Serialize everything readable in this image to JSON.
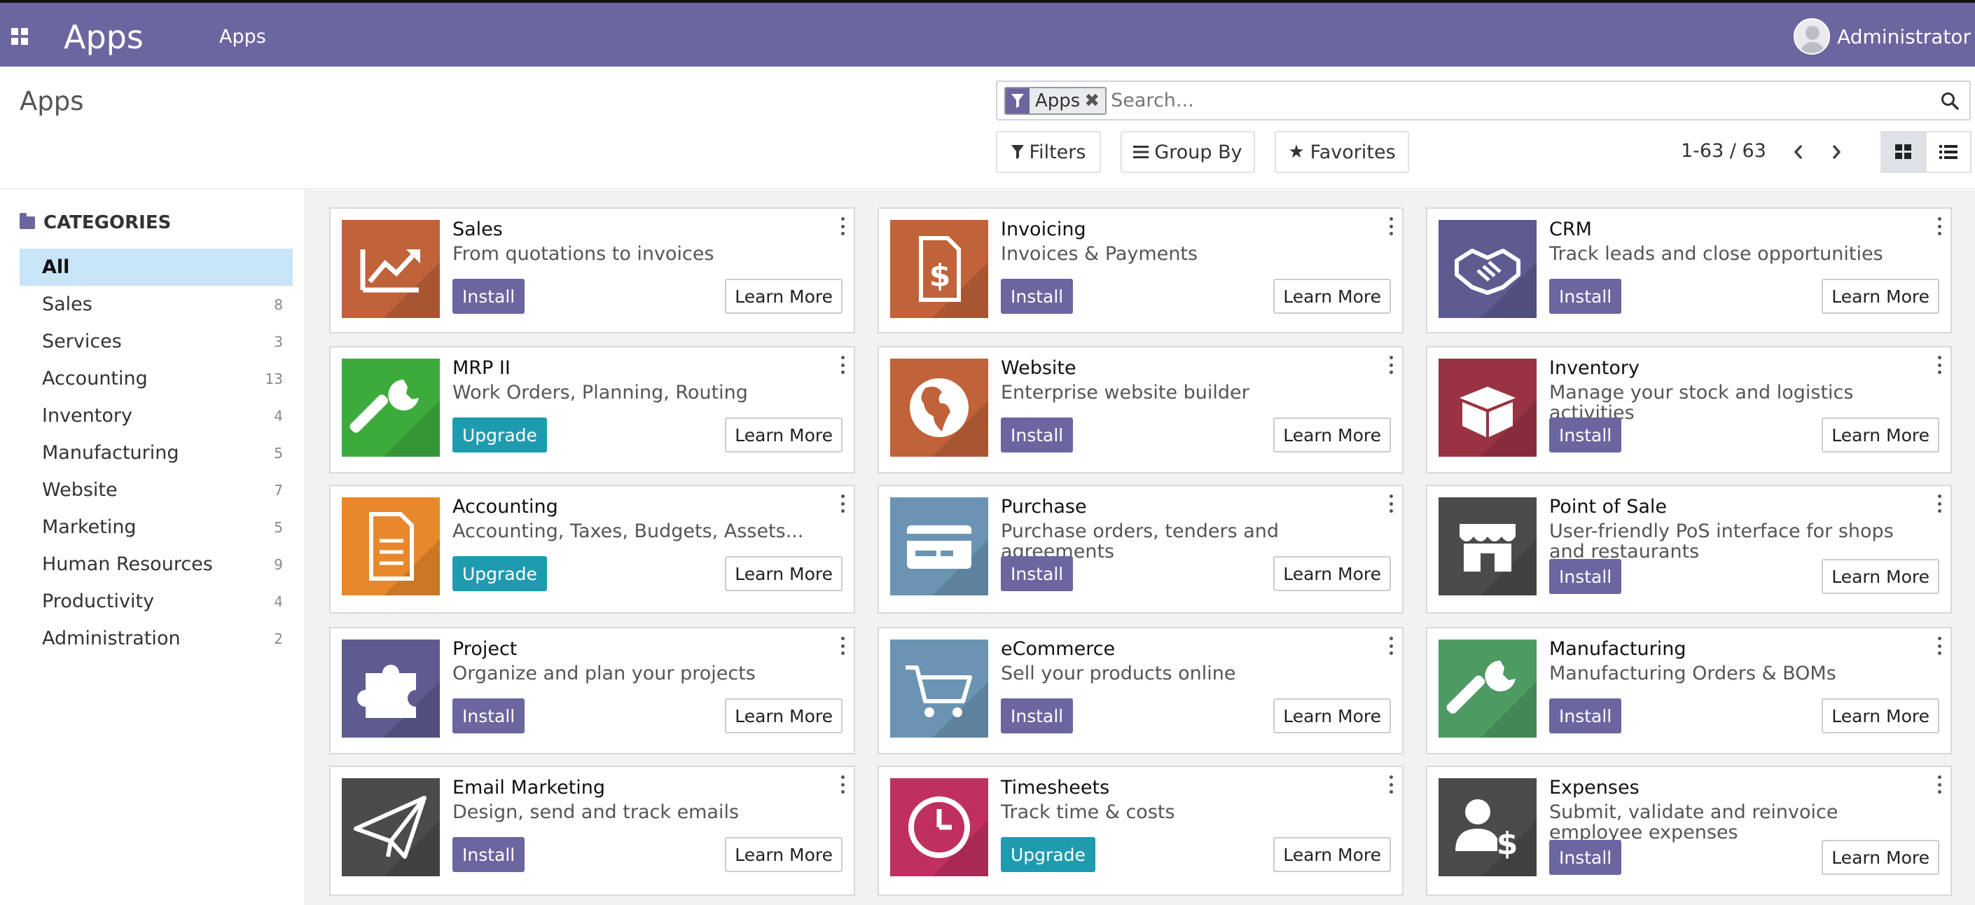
{
  "navbar": {
    "app_title": "Apps",
    "menu_item": "Apps",
    "user_name": "Administrator",
    "bg_color": "#6b65a0"
  },
  "control": {
    "breadcrumb": "Apps",
    "search": {
      "facet_label": "Apps",
      "placeholder": "Search..."
    },
    "filters_label": "Filters",
    "groupby_label": "Group By",
    "favorites_label": "Favorites",
    "pager": "1-63 / 63"
  },
  "sidebar": {
    "heading": "CATEGORIES",
    "items": [
      {
        "label": "All",
        "count": ""
      },
      {
        "label": "Sales",
        "count": "8"
      },
      {
        "label": "Services",
        "count": "3"
      },
      {
        "label": "Accounting",
        "count": "13"
      },
      {
        "label": "Inventory",
        "count": "4"
      },
      {
        "label": "Manufacturing",
        "count": "5"
      },
      {
        "label": "Website",
        "count": "7"
      },
      {
        "label": "Marketing",
        "count": "5"
      },
      {
        "label": "Human Resources",
        "count": "9"
      },
      {
        "label": "Productivity",
        "count": "4"
      },
      {
        "label": "Administration",
        "count": "2"
      }
    ]
  },
  "apps": [
    {
      "name": "Sales",
      "desc": "From quotations to invoices",
      "action": "Install",
      "learn": "Learn More",
      "icon": "trend-chart-icon",
      "color": "#c0623a"
    },
    {
      "name": "Invoicing",
      "desc": "Invoices & Payments",
      "action": "Install",
      "learn": "Learn More",
      "icon": "invoice-document-icon",
      "color": "#c0623a"
    },
    {
      "name": "CRM",
      "desc": "Track leads and close opportunities",
      "action": "Install",
      "learn": "Learn More",
      "icon": "handshake-icon",
      "color": "#5d5b8f"
    },
    {
      "name": "MRP II",
      "desc": "Work Orders, Planning, Routing",
      "action": "Upgrade",
      "learn": "Learn More",
      "icon": "wrench-icon",
      "color": "#3cab3c"
    },
    {
      "name": "Website",
      "desc": "Enterprise website builder",
      "action": "Install",
      "learn": "Learn More",
      "icon": "globe-icon",
      "color": "#c0623a"
    },
    {
      "name": "Inventory",
      "desc": "Manage your stock and logistics activities",
      "action": "Install",
      "learn": "Learn More",
      "icon": "box-icon",
      "color": "#993344"
    },
    {
      "name": "Accounting",
      "desc": "Accounting, Taxes, Budgets, Assets...",
      "action": "Upgrade",
      "learn": "Learn More",
      "icon": "ledger-document-icon",
      "color": "#e8882a"
    },
    {
      "name": "Purchase",
      "desc": "Purchase orders, tenders and agreements",
      "action": "Install",
      "learn": "Learn More",
      "icon": "credit-card-icon",
      "color": "#6b94b3"
    },
    {
      "name": "Point of Sale",
      "desc": "User-friendly PoS interface for shops and restaurants",
      "action": "Install",
      "learn": "Learn More",
      "icon": "shop-icon",
      "color": "#4b4b4b"
    },
    {
      "name": "Project",
      "desc": "Organize and plan your projects",
      "action": "Install",
      "learn": "Learn More",
      "icon": "puzzle-icon",
      "color": "#5d5b8f"
    },
    {
      "name": "eCommerce",
      "desc": "Sell your products online",
      "action": "Install",
      "learn": "Learn More",
      "icon": "cart-icon",
      "color": "#6b94b3"
    },
    {
      "name": "Manufacturing",
      "desc": "Manufacturing Orders & BOMs",
      "action": "Install",
      "learn": "Learn More",
      "icon": "wrench-icon",
      "color": "#4e9a63"
    },
    {
      "name": "Email Marketing",
      "desc": "Design, send and track emails",
      "action": "Install",
      "learn": "Learn More",
      "icon": "paper-plane-icon",
      "color": "#4b4b4b"
    },
    {
      "name": "Timesheets",
      "desc": "Track time & costs",
      "action": "Upgrade",
      "learn": "Learn More",
      "icon": "clock-icon",
      "color": "#c0305e"
    },
    {
      "name": "Expenses",
      "desc": "Submit, validate and reinvoice employee expenses",
      "action": "Install",
      "learn": "Learn More",
      "icon": "user-dollar-icon",
      "color": "#4b4b4b"
    }
  ]
}
